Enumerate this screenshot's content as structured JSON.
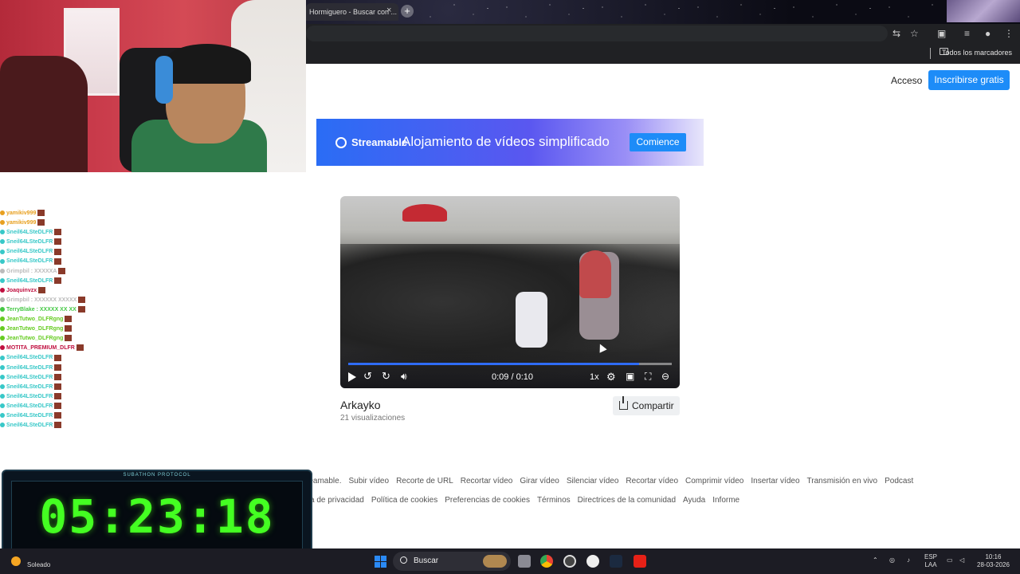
{
  "browser": {
    "tab_title": "Hormiguero - Buscar con ...",
    "tab_close": "×",
    "new_tab": "+",
    "bookmarks_label": "Todos los marcadores"
  },
  "page": {
    "login": "Acceso",
    "signup": "Inscribirse gratis",
    "banner": {
      "brand": "Streamable",
      "headline": "Alojamiento de vídeos simplificado",
      "cta": "Comience"
    },
    "video": {
      "time": "0:09 / 0:10",
      "progress": 0.9,
      "speed": "1x",
      "title": "Arkayko",
      "views": "21 visualizaciones",
      "share": "Compartir"
    },
    "footer_row1": [
      "reamable.",
      "Subir vídeo",
      "Recorte de URL",
      "Recortar vídeo",
      "Girar vídeo",
      "Silenciar vídeo",
      "Recortar vídeo",
      "Comprimir vídeo",
      "Insertar vídeo",
      "Transmisión en vivo",
      "Podcast"
    ],
    "footer_row2": [
      "ca de privacidad",
      "Política de cookies",
      "Preferencias de cookies",
      "Términos",
      "Directrices de la comunidad",
      "Ayuda",
      "Informe"
    ]
  },
  "chat": [
    {
      "user": "yamikiv999",
      "color": "#e8a020"
    },
    {
      "user": "yamikiv999",
      "color": "#e8a020"
    },
    {
      "user": "Sneil64LSteDLFR",
      "color": "#38c8c8"
    },
    {
      "user": "Sneil64LSteDLFR",
      "color": "#38c8c8"
    },
    {
      "user": "Sneil64LSteDLFR",
      "color": "#38c8c8"
    },
    {
      "user": "Sneil64LSteDLFR",
      "color": "#38c8c8"
    },
    {
      "user": "Grimpbil : XXXXXA",
      "color": "#bbbbbb"
    },
    {
      "user": "Sneil64LSteDLFR",
      "color": "#38c8c8"
    },
    {
      "user": "Joaquinvzx",
      "color": "#c01040"
    },
    {
      "user": "Grimpbil : XXXXXX XXXXX",
      "color": "#bbbbbb"
    },
    {
      "user": "TerryBlake : XXXXX XX XX",
      "color": "#44c844"
    },
    {
      "user": "JeanTutwo_DLFRgng",
      "color": "#66cc22"
    },
    {
      "user": "JeanTutwo_DLFRgng",
      "color": "#66cc22"
    },
    {
      "user": "JeanTutwo_DLFRgng",
      "color": "#66cc22"
    },
    {
      "user": "MOTITA_PREMIUM_DLFR",
      "color": "#c01040"
    },
    {
      "user": "Sneil64LSteDLFR",
      "color": "#38c8c8"
    },
    {
      "user": "Sneil64LSteDLFR",
      "color": "#38c8c8"
    },
    {
      "user": "Sneil64LSteDLFR",
      "color": "#38c8c8"
    },
    {
      "user": "Sneil64LSteDLFR",
      "color": "#38c8c8"
    },
    {
      "user": "Sneil64LSteDLFR",
      "color": "#38c8c8"
    },
    {
      "user": "Sneil64LSteDLFR",
      "color": "#38c8c8"
    },
    {
      "user": "Sneil64LSteDLFR",
      "color": "#38c8c8"
    },
    {
      "user": "Sneil64LSteDLFR",
      "color": "#38c8c8"
    }
  ],
  "timer": {
    "label": "SUBATHON PROTOCOL",
    "time": "05:23:18",
    "color": "#44ff22"
  },
  "taskbar": {
    "weather": "Soleado",
    "search": "Buscar",
    "lang": "ESP",
    "lang2": "LAA",
    "time": "10:16",
    "date": "28-03-2026"
  }
}
